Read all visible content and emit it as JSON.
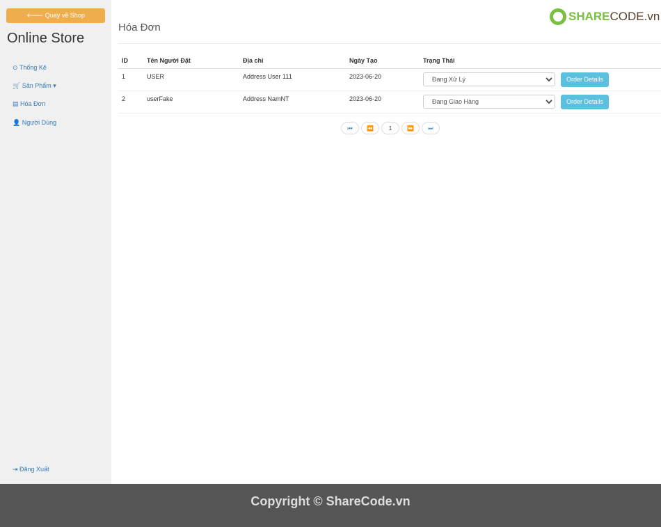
{
  "sidebar": {
    "back_label": "🡐 Quay về Shop",
    "brand": "Online Store",
    "items": [
      {
        "icon": "⊙",
        "label": "Thống Kê"
      },
      {
        "icon": "🛒",
        "label": "Sản Phẩm ▾"
      },
      {
        "icon": "▤",
        "label": "Hóa Đơn"
      },
      {
        "icon": "👤",
        "label": "Người Dùng"
      }
    ],
    "logout": "⇥ Đăng Xuất"
  },
  "header": {
    "title": "Hóa Đơn",
    "logo_a": "SHARE",
    "logo_b": "CODE.vn"
  },
  "table": {
    "headers": [
      "ID",
      "Tên Người Đặt",
      "Địa chỉ",
      "Ngày Tạo",
      "Trạng Thái"
    ],
    "rows": [
      {
        "id": "1",
        "name": "USER",
        "address": "Address User 111",
        "date": "2023-06-20",
        "status": "Đang Xử Lý"
      },
      {
        "id": "2",
        "name": "userFake",
        "address": "Address NamNT",
        "date": "2023-06-20",
        "status": "Đang Giao Hàng"
      }
    ],
    "details_label": "Order Details"
  },
  "pagination": {
    "first": "⏮",
    "prev": "⏪",
    "page": "1",
    "next": "⏩",
    "last": "⏭"
  },
  "footer": {
    "text": "Copyright © ShareCode.vn"
  }
}
